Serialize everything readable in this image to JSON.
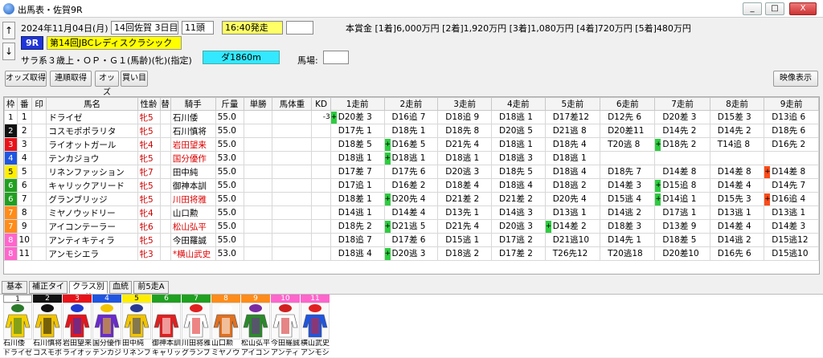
{
  "window": {
    "title": "出馬表・佐賀9R",
    "min_label": "_",
    "max_label": "□",
    "close_label": "X"
  },
  "header": {
    "date": "2024年11月04日(月)",
    "kaisai": "14回佐賀 3日目",
    "heads": "11頭",
    "post_time": "16:40発走",
    "race_no": "9R",
    "race_name": "第14回JBCレディスクラシック",
    "race_conditions": "サラ系３歳上・ＯＰ・Ｇ１(馬齢)(牝)(指定)",
    "course": "ダ1860m",
    "baba_label": "馬場:",
    "prize": "本賞金 [1着]6,000万円 [2着]1,920万円 [3着]1,080万円 [4着]720万円 [5着]480万円",
    "up_arrow": "↑",
    "down_arrow": "↓"
  },
  "toolbar": {
    "odds": "オッズ取得",
    "renpuku": "連順取得",
    "odds_buy": "オッズ",
    "buy": "買い目",
    "video": "映像表示"
  },
  "table": {
    "columns": [
      "枠",
      "番",
      "印",
      "馬名",
      "性齢",
      "替",
      "騎手",
      "斤量",
      "単勝",
      "馬体重",
      "KD",
      "1走前",
      "2走前",
      "3走前",
      "4走前",
      "5走前",
      "6走前",
      "7走前",
      "8走前",
      "9走前"
    ],
    "waku_colors": {
      "1": "#ffffff",
      "2": "#111111",
      "3": "#e8131a",
      "4": "#1f55e0",
      "5": "#ffee00",
      "6": "#20a020",
      "7": "#ff8c1a",
      "8": "#ff66cc"
    },
    "rows": [
      {
        "waku": "1",
        "num": "1",
        "name": "ドライゼ",
        "sex": "牝5",
        "jockey": "石川倭",
        "jred": false,
        "kin": "55.0",
        "kd": "-3",
        "past": [
          [
            "up",
            "D20差 3"
          ],
          [
            "",
            "D16追 7"
          ],
          [
            "",
            "D18追 9"
          ],
          [
            "",
            "D18逃 1"
          ],
          [
            "",
            "D17差12"
          ],
          [
            "",
            "D12先 6"
          ],
          [
            "",
            "D20差 3"
          ],
          [
            "",
            "D15差 3"
          ],
          [
            "",
            "D13追 6"
          ]
        ]
      },
      {
        "waku": "2",
        "num": "2",
        "name": "コスモポポラリタ",
        "sex": "牝5",
        "jockey": "石川慎将",
        "jred": false,
        "kin": "55.0",
        "kd": "",
        "past": [
          [
            "",
            "D17先 1"
          ],
          [
            "",
            "D18先 1"
          ],
          [
            "",
            "D18先 8"
          ],
          [
            "",
            "D20逃 5"
          ],
          [
            "",
            "D21逃 8"
          ],
          [
            "",
            "D20差11"
          ],
          [
            "",
            "D14先 2"
          ],
          [
            "",
            "D14先 2"
          ],
          [
            "",
            "D18先 6"
          ]
        ]
      },
      {
        "waku": "3",
        "num": "3",
        "name": "ライオットガール",
        "sex": "牝4",
        "jockey": "岩田望来",
        "jred": true,
        "kin": "55.0",
        "kd": "",
        "past": [
          [
            "",
            "D18差 5"
          ],
          [
            "up",
            "D16差 5"
          ],
          [
            "",
            "D21先 4"
          ],
          [
            "",
            "D18逃 1"
          ],
          [
            "",
            "D18先 4"
          ],
          [
            "",
            "T20逃 8"
          ],
          [
            "up",
            "D18先 2"
          ],
          [
            "",
            "T14追 8"
          ],
          [
            "",
            "D16先 2"
          ]
        ]
      },
      {
        "waku": "4",
        "num": "4",
        "name": "テンカジョウ",
        "sex": "牝5",
        "jockey": "国分優作",
        "jred": true,
        "kin": "53.0",
        "kd": "",
        "past": [
          [
            "",
            "D18逃 1"
          ],
          [
            "up",
            "D18逃 1"
          ],
          [
            "",
            "D18逃 1"
          ],
          [
            "",
            "D18逃 3"
          ],
          [
            "",
            "D18逃 1"
          ],
          [
            "",
            ""
          ],
          [
            "",
            ""
          ],
          [
            "",
            ""
          ],
          [
            "",
            ""
          ]
        ]
      },
      {
        "waku": "5",
        "num": "5",
        "name": "リネンファッション",
        "sex": "牝7",
        "jockey": "田中純",
        "jred": false,
        "kin": "55.0",
        "kd": "",
        "past": [
          [
            "",
            "D17差 7"
          ],
          [
            "",
            "D17先 6"
          ],
          [
            "",
            "D20逃 3"
          ],
          [
            "",
            "D18先 5"
          ],
          [
            "",
            "D18逃 4"
          ],
          [
            "",
            "D18先 7"
          ],
          [
            "",
            "D14差 8"
          ],
          [
            "",
            "D14差 8"
          ],
          [
            "dn",
            "D14差 8"
          ]
        ]
      },
      {
        "waku": "6",
        "num": "6",
        "name": "キャリックアリード",
        "sex": "牝5",
        "jockey": "御神本訓",
        "jred": false,
        "kin": "55.0",
        "kd": "",
        "past": [
          [
            "",
            "D17追 1"
          ],
          [
            "",
            "D16差 2"
          ],
          [
            "",
            "D18差 4"
          ],
          [
            "",
            "D18逃 4"
          ],
          [
            "",
            "D18逃 2"
          ],
          [
            "",
            "D14差 3"
          ],
          [
            "up",
            "D15追 8"
          ],
          [
            "",
            "D14差 4"
          ],
          [
            "",
            "D14先 7"
          ]
        ]
      },
      {
        "waku": "6",
        "num": "7",
        "name": "グランブリッジ",
        "sex": "牝5",
        "jockey": "川田将雅",
        "jred": true,
        "kin": "55.0",
        "kd": "",
        "past": [
          [
            "",
            "D18差 1"
          ],
          [
            "up",
            "D20先 4"
          ],
          [
            "",
            "D21差 2"
          ],
          [
            "",
            "D21差 2"
          ],
          [
            "",
            "D20先 4"
          ],
          [
            "",
            "D15逃 4"
          ],
          [
            "up",
            "D14追 1"
          ],
          [
            "",
            "D15先 3"
          ],
          [
            "dn",
            "D16追 4"
          ]
        ]
      },
      {
        "waku": "7",
        "num": "8",
        "name": "ミヤノウッドリー",
        "sex": "牝4",
        "jockey": "山口勲",
        "jred": false,
        "kin": "55.0",
        "kd": "",
        "past": [
          [
            "",
            "D14逃 1"
          ],
          [
            "",
            "D14差 4"
          ],
          [
            "",
            "D13先 1"
          ],
          [
            "",
            "D14逃 3"
          ],
          [
            "",
            "D13逃 1"
          ],
          [
            "",
            "D14逃 2"
          ],
          [
            "",
            "D17逃 1"
          ],
          [
            "",
            "D13逃 1"
          ],
          [
            "",
            "D13逃 1"
          ]
        ]
      },
      {
        "waku": "7",
        "num": "9",
        "name": "アイコンテーラー",
        "sex": "牝6",
        "jockey": "松山弘平",
        "jred": true,
        "kin": "55.0",
        "kd": "",
        "past": [
          [
            "",
            "D18先 2"
          ],
          [
            "up",
            "D21逃 5"
          ],
          [
            "",
            "D21先 4"
          ],
          [
            "",
            "D20逃 3"
          ],
          [
            "up",
            "D14差 2"
          ],
          [
            "",
            "D18差 3"
          ],
          [
            "",
            "D13差 9"
          ],
          [
            "",
            "D14差 4"
          ],
          [
            "",
            "D14差 3"
          ]
        ]
      },
      {
        "waku": "8",
        "num": "10",
        "name": "アンティキティラ",
        "sex": "牝5",
        "jockey": "今田羅誠",
        "jred": false,
        "kin": "55.0",
        "kd": "",
        "past": [
          [
            "",
            "D18追 7"
          ],
          [
            "",
            "D17差 6"
          ],
          [
            "",
            "D15逃 1"
          ],
          [
            "",
            "D17逃 2"
          ],
          [
            "",
            "D21逃10"
          ],
          [
            "",
            "D14先 1"
          ],
          [
            "",
            "D18差 5"
          ],
          [
            "",
            "D14逃 2"
          ],
          [
            "",
            "D15逃12"
          ]
        ]
      },
      {
        "waku": "8",
        "num": "11",
        "name": "アンモシエラ",
        "sex": "牝3",
        "jockey": "*横山武史",
        "jred": true,
        "kin": "53.0",
        "kd": "",
        "past": [
          [
            "",
            "D18逃 4"
          ],
          [
            "up",
            "D20逃 3"
          ],
          [
            "",
            "D18逃 2"
          ],
          [
            "",
            "D17差 2"
          ],
          [
            "",
            "T26先12"
          ],
          [
            "",
            "T20逃18"
          ],
          [
            "",
            "D20差10"
          ],
          [
            "",
            "D16先 6"
          ],
          [
            "",
            "D15逃10"
          ]
        ]
      }
    ]
  },
  "tabs": [
    "基本",
    "補正タイム",
    "クラス別着",
    "血統",
    "前5走A"
  ],
  "silks": [
    {
      "num": "1",
      "jockey": "石川倭",
      "horse": "ドライゼ",
      "bg": "#ffffff",
      "fg": "#000",
      "c1": "#f5d000",
      "c2": "#2a7a2a"
    },
    {
      "num": "2",
      "jockey": "石川慎将",
      "horse": "コスモポポラ",
      "bg": "#111111",
      "fg": "#fff",
      "c1": "#f2c400",
      "c2": "#111111"
    },
    {
      "num": "3",
      "jockey": "岩田望来",
      "horse": "ライオットガ",
      "bg": "#e8131a",
      "fg": "#fff",
      "c1": "#e8131a",
      "c2": "#1f3ad0"
    },
    {
      "num": "4",
      "jockey": "国分優作",
      "horse": "テンカジョウ",
      "bg": "#1f55e0",
      "fg": "#fff",
      "c1": "#6a2ad0",
      "c2": "#f2c400"
    },
    {
      "num": "5",
      "jockey": "田中純",
      "horse": "リネンファッ",
      "bg": "#ffee00",
      "fg": "#000",
      "c1": "#f2c400",
      "c2": "#2a3a90"
    },
    {
      "num": "6",
      "jockey": "御神本訓",
      "horse": "キャリック",
      "bg": "#20a020",
      "fg": "#fff",
      "c1": "#e02020",
      "c2": "#ffffff"
    },
    {
      "num": "7",
      "jockey": "川田将雅",
      "horse": "グランブリ",
      "bg": "#20a020",
      "fg": "#fff",
      "c1": "#ffffff",
      "c2": "#e02020"
    },
    {
      "num": "8",
      "jockey": "山口勲",
      "horse": "ミヤノウッ",
      "bg": "#ff8c1a",
      "fg": "#fff",
      "c1": "#e07020",
      "c2": "#ffffff"
    },
    {
      "num": "9",
      "jockey": "松山弘平",
      "horse": "アイコンテ",
      "bg": "#ff8c1a",
      "fg": "#fff",
      "c1": "#2a8a2a",
      "c2": "#7a2aa0"
    },
    {
      "num": "10",
      "jockey": "今田羅誠",
      "horse": "アンティキ",
      "bg": "#ff66cc",
      "fg": "#fff",
      "c1": "#ffffff",
      "c2": "#d02020"
    },
    {
      "num": "11",
      "jockey": "横山武史",
      "horse": "アンモシエ",
      "bg": "#ff66cc",
      "fg": "#fff",
      "c1": "#1f55e0",
      "c2": "#e02020"
    }
  ]
}
